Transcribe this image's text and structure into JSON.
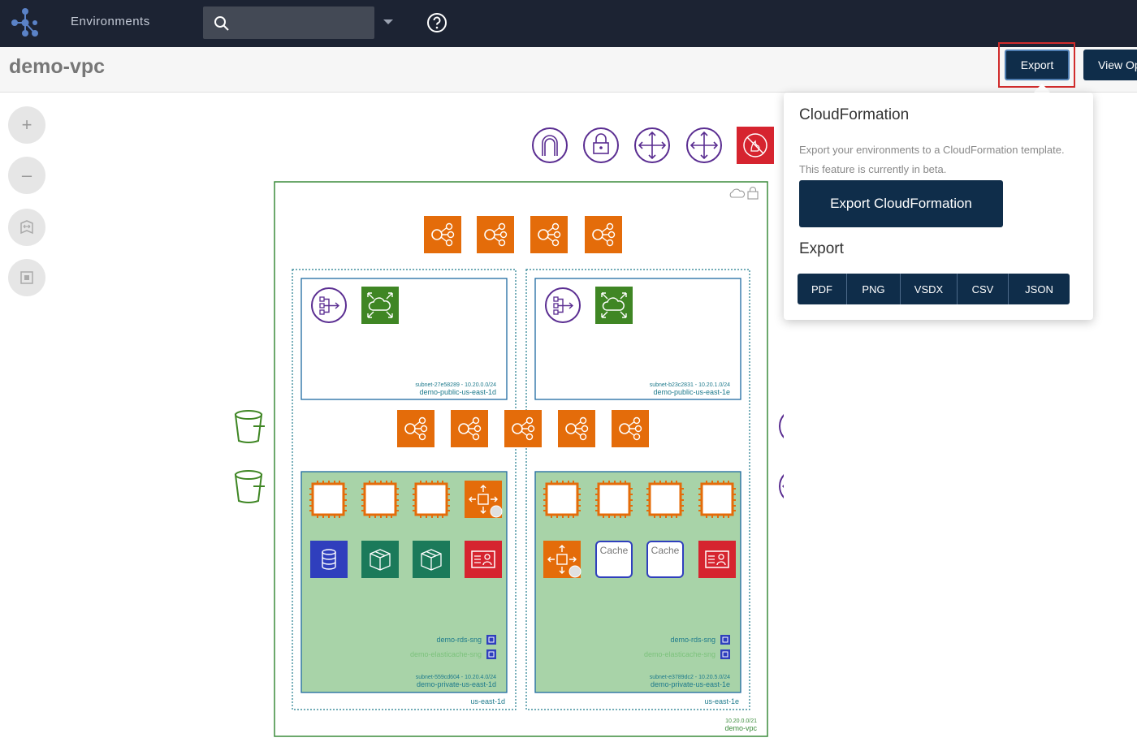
{
  "topbar": {
    "nav_label": "Environments",
    "search": {
      "value": "",
      "placeholder": ""
    },
    "icons": [
      "app-logo-icon",
      "search-icon",
      "chevron-down-icon",
      "help-icon"
    ]
  },
  "header": {
    "title": "demo-vpc",
    "export_label": "Export",
    "view_label": "View Op"
  },
  "left_controls": [
    "zoom-in-icon",
    "zoom-out-icon",
    "fit-map-icon",
    "focus-icon"
  ],
  "export_menu": {
    "title": "CloudFormation",
    "desc_line1": "Export your environments to a CloudFormation template.",
    "desc_line2": "This feature is currently in beta.",
    "cf_button": "Export CloudFormation",
    "export_title": "Export",
    "formats": [
      "PDF",
      "PNG",
      "VSDX",
      "CSV",
      "JSON"
    ]
  },
  "diagram": {
    "vpc": {
      "name": "demo-vpc",
      "cidr": "10.20.0.0/21"
    },
    "az_left": "us-east-1d",
    "az_right": "us-east-1e",
    "public_left": {
      "id": "subnet-27e58289 - 10.20.0.0/24",
      "name": "demo-public-us-east-1d"
    },
    "public_right": {
      "id": "subnet-b23c2831 - 10.20.1.0/24",
      "name": "demo-public-us-east-1e"
    },
    "private_left": {
      "id": "subnet-559cd604 - 10.20.4.0/24",
      "name": "demo-private-us-east-1d",
      "sg1": "demo-rds-sng",
      "sg2": "demo-elasticache-sng"
    },
    "private_right": {
      "id": "subnet-e3789dc2 - 10.20.5.0/24",
      "name": "demo-private-us-east-1e",
      "sg1": "demo-rds-sng",
      "sg2": "demo-elasticache-sng"
    },
    "cache_label": "Cache",
    "colors": {
      "orange": "#e46c0a",
      "green": "#3f8624",
      "purple": "#5a2d91",
      "red": "#d6242f",
      "teal": "#1b7a5a",
      "blue": "#2f3fbd",
      "subnet_fill": "#a8d3a8",
      "vpc_border": "#3b8c3b"
    }
  }
}
